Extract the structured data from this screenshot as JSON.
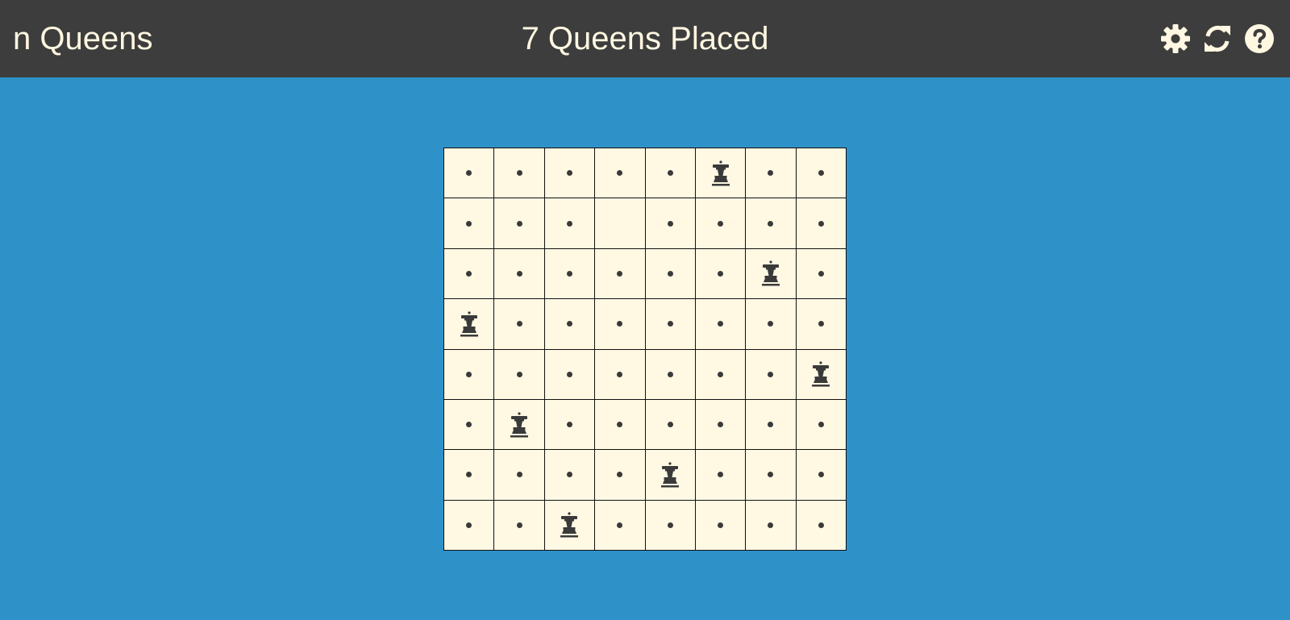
{
  "app": {
    "title": "n Queens",
    "status": "7 Queens Placed"
  },
  "toolbar": {
    "icons": [
      "gear-icon",
      "refresh-icon",
      "help-icon"
    ]
  },
  "colors": {
    "header_bg": "#3d3d3d",
    "header_text": "#fff7e1",
    "page_bg": "#2e92c9",
    "cell_bg": "#fff8e3",
    "piece": "#3a3a3a"
  },
  "board": {
    "size": 8,
    "rows": [
      [
        "dot",
        "dot",
        "dot",
        "dot",
        "dot",
        "queen",
        "dot",
        "dot"
      ],
      [
        "dot",
        "dot",
        "dot",
        "empty",
        "dot",
        "dot",
        "dot",
        "dot"
      ],
      [
        "dot",
        "dot",
        "dot",
        "dot",
        "dot",
        "dot",
        "queen",
        "dot"
      ],
      [
        "queen",
        "dot",
        "dot",
        "dot",
        "dot",
        "dot",
        "dot",
        "dot"
      ],
      [
        "dot",
        "dot",
        "dot",
        "dot",
        "dot",
        "dot",
        "dot",
        "queen"
      ],
      [
        "dot",
        "queen",
        "dot",
        "dot",
        "dot",
        "dot",
        "dot",
        "dot"
      ],
      [
        "dot",
        "dot",
        "dot",
        "dot",
        "queen",
        "dot",
        "dot",
        "dot"
      ],
      [
        "dot",
        "dot",
        "queen",
        "dot",
        "dot",
        "dot",
        "dot",
        "dot"
      ]
    ]
  }
}
